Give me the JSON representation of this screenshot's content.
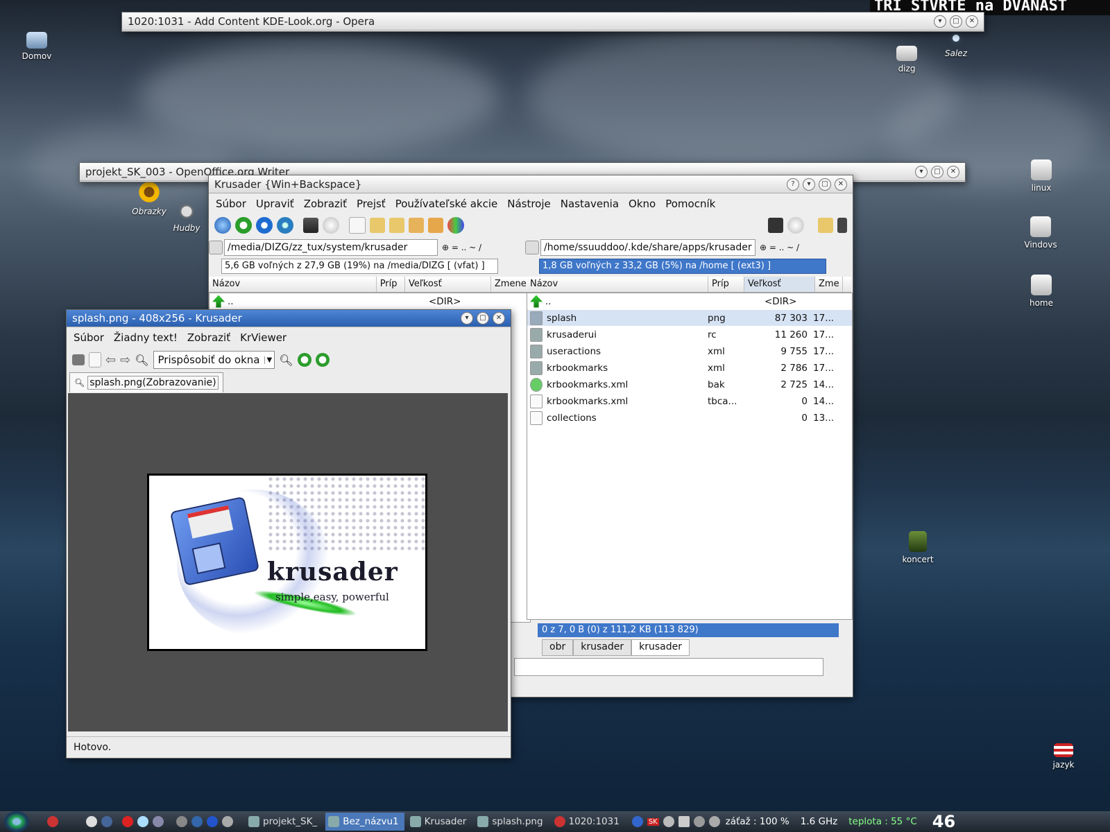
{
  "desktop": {
    "banner": "TRI STVRTE na DVANAST",
    "icons": [
      {
        "label": "Domov"
      },
      {
        "label": "Obrazky"
      },
      {
        "label": "Hudby"
      },
      {
        "label": "dizg"
      },
      {
        "label": "Salez"
      },
      {
        "label": "linux"
      },
      {
        "label": "Vindovs"
      },
      {
        "label": "home"
      },
      {
        "label": "koncert"
      },
      {
        "label": "jazyk"
      }
    ]
  },
  "opera": {
    "title": "1020:1031 - Add Content KDE-Look.org - Opera"
  },
  "writer": {
    "title": "projekt_SK_003 - OpenOffice.org Writer"
  },
  "krusader": {
    "title": "Krusader {Win+Backspace}",
    "menu": [
      "Súbor",
      "Upraviť",
      "Zobraziť",
      "Prejsť",
      "Používateľské akcie",
      "Nástroje",
      "Nastavenia",
      "Okno",
      "Pomocník"
    ],
    "left": {
      "path": "/media/DIZG/zz_tux/system/krusader",
      "free": "5,6 GB voľných z 27,9 GB (19%) na /media/DIZG [ (vfat) ]",
      "columns": [
        "Názov",
        "Príp",
        "Veľkosť",
        "Zmene"
      ],
      "up_row": {
        "name": "..",
        "size": "<DIR>"
      }
    },
    "right": {
      "path": "/home/ssuuddoo/.kde/share/apps/krusader",
      "free": "1,8 GB voľných z 33,2 GB (5%) na /home [ (ext3) ]",
      "columns": [
        "Názov",
        "Príp",
        "Veľkosť",
        "Zme"
      ],
      "up_row": {
        "name": "..",
        "size": "<DIR>"
      },
      "files": [
        {
          "name": "splash",
          "ext": "png",
          "size": "87 303",
          "date": "17..."
        },
        {
          "name": "krusaderui",
          "ext": "rc",
          "size": "11 260",
          "date": "17..."
        },
        {
          "name": "useractions",
          "ext": "xml",
          "size": "9 755",
          "date": "17..."
        },
        {
          "name": "krbookmarks",
          "ext": "xml",
          "size": "2 786",
          "date": "17..."
        },
        {
          "name": "krbookmarks.xml",
          "ext": "bak",
          "size": "2 725",
          "date": "14..."
        },
        {
          "name": "krbookmarks.xml",
          "ext": "tbca...",
          "size": "0",
          "date": "14..."
        },
        {
          "name": "collections",
          "ext": "",
          "size": "0",
          "date": "13..."
        }
      ],
      "status": "0 z 7, 0 B (0) z 111,2 KB (113 829)",
      "tabs": [
        "obr",
        "krusader",
        "krusader"
      ]
    }
  },
  "viewer": {
    "title": "splash.png - 408x256 - Krusader",
    "menu": [
      "Súbor",
      "Žiadny text!",
      "Zobraziť",
      "KrViewer"
    ],
    "zoom_select": "Prispôsobiť do okna",
    "tab": "splash.png(Zobrazovanie)",
    "status": "Hotovo.",
    "image": {
      "logo_text": "krusader",
      "tagline": "simple,easy, powerful"
    }
  },
  "taskbar": {
    "tasks": [
      "projekt_SK_",
      "Bez_názvu1",
      "Krusader",
      "splash.png",
      "1020:1031"
    ],
    "load": "záťaž : 100 %",
    "cpu": "1.6 GHz",
    "temp": "teplota : 55 °C",
    "clock": "46"
  }
}
